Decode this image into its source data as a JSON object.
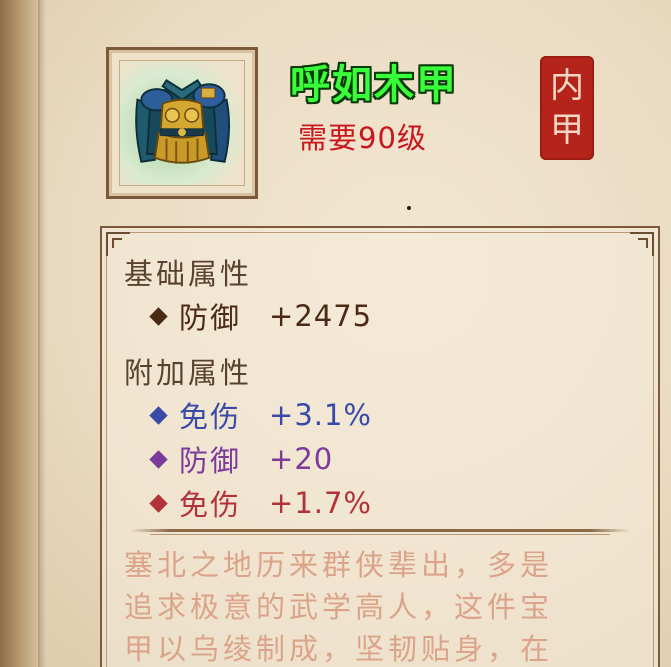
{
  "item": {
    "name": "呼如木甲",
    "requirement": "需要90级",
    "seal_chars": [
      "内",
      "甲"
    ],
    "icon": "armor-icon"
  },
  "base_attributes": {
    "title": "基础属性",
    "stats": [
      {
        "name": "防御",
        "value": "+2475",
        "color": "#4a2a14"
      }
    ]
  },
  "extra_attributes": {
    "title": "附加属性",
    "stats": [
      {
        "name": "免伤",
        "value": "+3.1%",
        "color": "#3a4aa8"
      },
      {
        "name": "防御",
        "value": "+20",
        "color": "#7c3a9a"
      },
      {
        "name": "免伤",
        "value": "+1.7%",
        "color": "#b2323a"
      }
    ]
  },
  "description": "塞北之地历来群侠辈出，多是\n追求极意的武学高人，这件宝\n甲以乌绫制成，坚韧贴身，在",
  "colors": {
    "name": "#39ff3a",
    "requirement": "#c8161c",
    "seal": "#b5241b",
    "description": "#dba48a"
  }
}
